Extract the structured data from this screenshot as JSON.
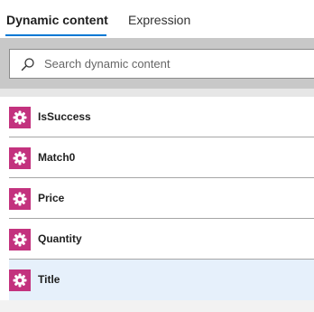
{
  "tabs": [
    {
      "label": "Dynamic content",
      "active": true
    },
    {
      "label": "Expression",
      "active": false
    }
  ],
  "search": {
    "placeholder": "Search dynamic content",
    "value": ""
  },
  "items": [
    {
      "label": "IsSuccess",
      "icon": "gear-icon",
      "selected": false
    },
    {
      "label": "Match0",
      "icon": "gear-icon",
      "selected": false
    },
    {
      "label": "Price",
      "icon": "gear-icon",
      "selected": false
    },
    {
      "label": "Quantity",
      "icon": "gear-icon",
      "selected": false
    },
    {
      "label": "Title",
      "icon": "gear-icon",
      "selected": true
    }
  ],
  "colors": {
    "accent": "#0078d4",
    "icon_background": "#c3327e",
    "selected_row": "#e6f0fb",
    "search_zone": "#c8c8c8"
  }
}
